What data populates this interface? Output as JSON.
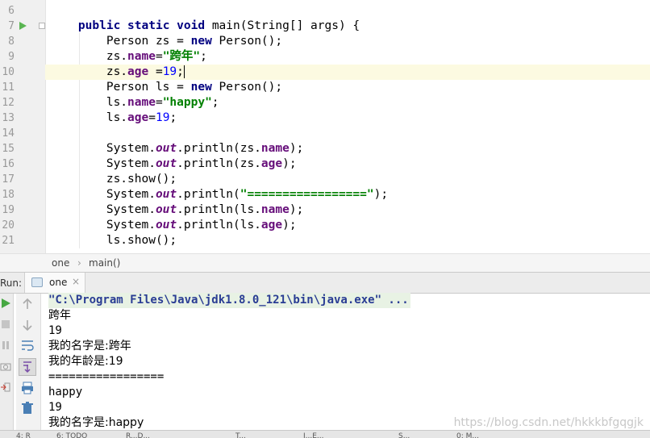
{
  "editor": {
    "line_numbers": [
      "6",
      "7",
      "8",
      "9",
      "10",
      "11",
      "12",
      "13",
      "14",
      "15",
      "16",
      "17",
      "18",
      "19",
      "20",
      "21"
    ],
    "lines": [
      [],
      [
        {
          "t": "    "
        },
        {
          "t": "public",
          "c": "kw"
        },
        {
          "t": " "
        },
        {
          "t": "static",
          "c": "kw"
        },
        {
          "t": " "
        },
        {
          "t": "void",
          "c": "kw"
        },
        {
          "t": " main(String[] args) {"
        }
      ],
      [
        {
          "t": "        Person zs = "
        },
        {
          "t": "new",
          "c": "kw"
        },
        {
          "t": " Person();"
        }
      ],
      [
        {
          "t": "        zs."
        },
        {
          "t": "name",
          "c": "fld"
        },
        {
          "t": "="
        },
        {
          "t": "\"跨年\"",
          "c": "str"
        },
        {
          "t": ";"
        }
      ],
      [
        {
          "t": "        zs."
        },
        {
          "t": "age",
          "c": "fld"
        },
        {
          "t": " ="
        },
        {
          "t": "19",
          "c": "num"
        },
        {
          "t": ";"
        },
        {
          "caret": true
        }
      ],
      [
        {
          "t": "        Person ls = "
        },
        {
          "t": "new",
          "c": "kw"
        },
        {
          "t": " Person();"
        }
      ],
      [
        {
          "t": "        ls."
        },
        {
          "t": "name",
          "c": "fld"
        },
        {
          "t": "="
        },
        {
          "t": "\"happy\"",
          "c": "str"
        },
        {
          "t": ";"
        }
      ],
      [
        {
          "t": "        ls."
        },
        {
          "t": "age",
          "c": "fld"
        },
        {
          "t": "="
        },
        {
          "t": "19",
          "c": "num"
        },
        {
          "t": ";"
        }
      ],
      [],
      [
        {
          "t": "        System."
        },
        {
          "t": "out",
          "c": "sfld"
        },
        {
          "t": ".println(zs."
        },
        {
          "t": "name",
          "c": "fld"
        },
        {
          "t": ");"
        }
      ],
      [
        {
          "t": "        System."
        },
        {
          "t": "out",
          "c": "sfld"
        },
        {
          "t": ".println(zs."
        },
        {
          "t": "age",
          "c": "fld"
        },
        {
          "t": ");"
        }
      ],
      [
        {
          "t": "        zs.show();"
        }
      ],
      [
        {
          "t": "        System."
        },
        {
          "t": "out",
          "c": "sfld"
        },
        {
          "t": ".println("
        },
        {
          "t": "\"=================\"",
          "c": "str"
        },
        {
          "t": ");"
        }
      ],
      [
        {
          "t": "        System."
        },
        {
          "t": "out",
          "c": "sfld"
        },
        {
          "t": ".println(ls."
        },
        {
          "t": "name",
          "c": "fld"
        },
        {
          "t": ");"
        }
      ],
      [
        {
          "t": "        System."
        },
        {
          "t": "out",
          "c": "sfld"
        },
        {
          "t": ".println(ls."
        },
        {
          "t": "age",
          "c": "fld"
        },
        {
          "t": ");"
        }
      ],
      [
        {
          "t": "        ls.show();"
        }
      ]
    ],
    "current_line_index": 4,
    "run_line_index": 1
  },
  "breadcrumb": {
    "items": [
      "one",
      "main()"
    ]
  },
  "run_panel": {
    "label": "Run:",
    "tab_label": "one",
    "close_glyph": "×"
  },
  "console": {
    "command": "\"C:\\Program Files\\Java\\jdk1.8.0_121\\bin\\java.exe\" ...",
    "lines": [
      "跨年",
      "19",
      "我的名字是:跨年",
      "我的年龄是:19",
      "=================",
      "happy",
      "19",
      "我的名字是:happy"
    ]
  },
  "watermark": "https://blog.csdn.net/hkkkbfgqgjk",
  "bottom_bar": {
    "items": [
      "4: R",
      "6: TODO",
      "R...D...",
      "T...",
      "J...E...",
      "S...",
      "0: M..."
    ]
  },
  "colors": {
    "run_green": "#5ab552",
    "keyword": "#000080",
    "string": "#008000",
    "field": "#660e7a",
    "number": "#0000ff"
  }
}
